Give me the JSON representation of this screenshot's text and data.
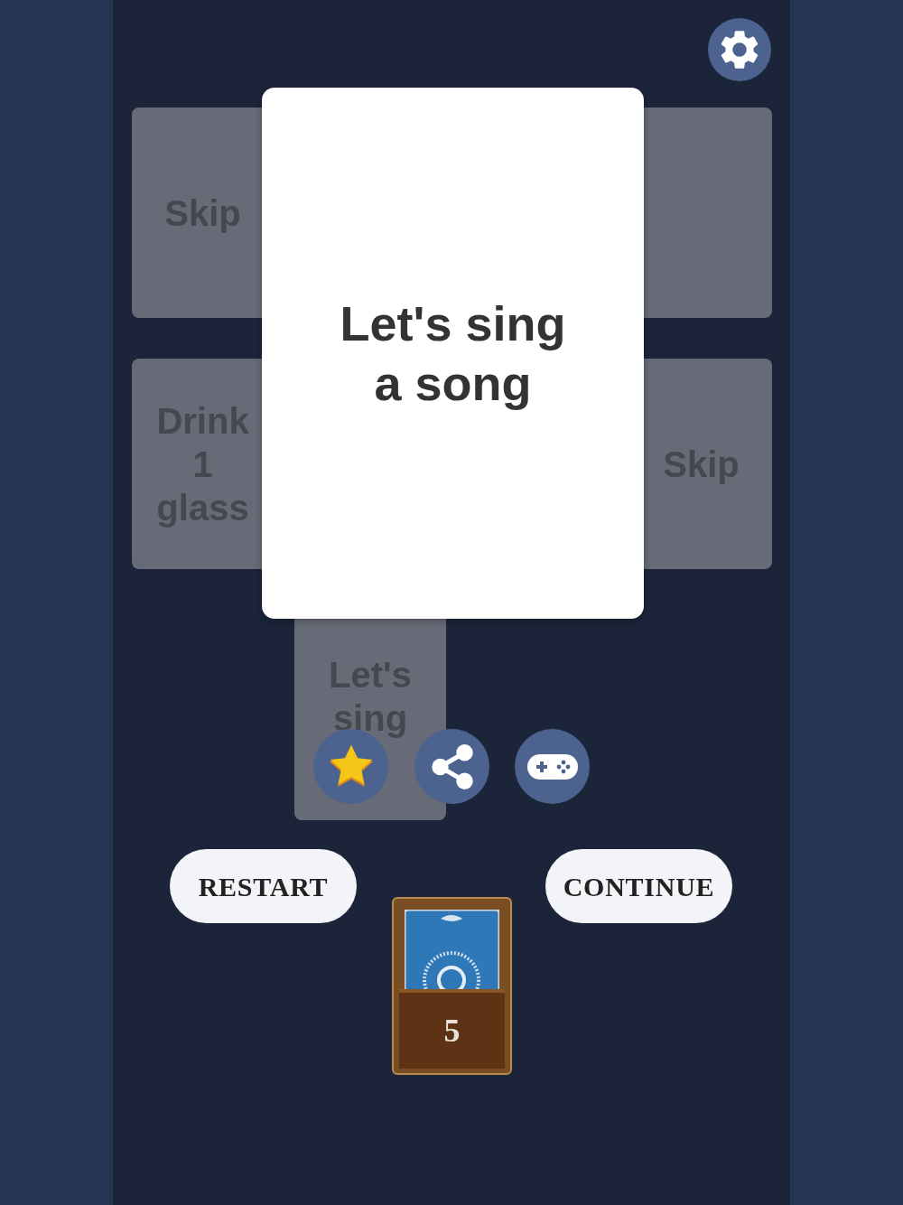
{
  "tiles": [
    {
      "kind": "text",
      "text": "Skip"
    },
    {
      "kind": "blank"
    },
    {
      "kind": "text",
      "text": "Drink 1 glass"
    },
    {
      "kind": "text",
      "text": "Skip"
    },
    {
      "kind": "text",
      "text": "Let's sing"
    }
  ],
  "current_card": {
    "text": "Let's sing a song"
  },
  "actions": [
    {
      "kind": "star"
    },
    {
      "kind": "share"
    },
    {
      "kind": "gamepad"
    }
  ],
  "buttons": [
    "RESTART",
    "CONTINUE"
  ],
  "deck": {
    "count": "5"
  }
}
